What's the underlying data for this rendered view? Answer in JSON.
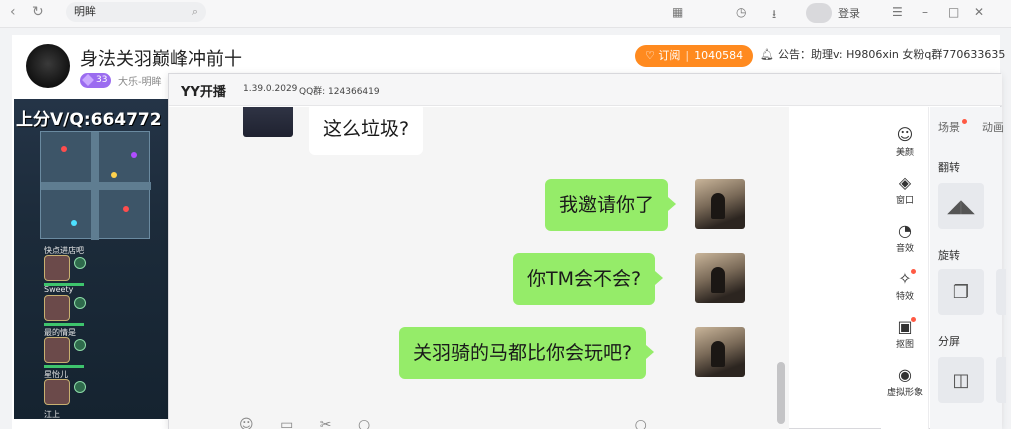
{
  "browser": {
    "search_value": "明眸",
    "search_icon": "search-icon",
    "login_label": "登录"
  },
  "room": {
    "title": "身法关羽巅峰冲前十",
    "level": "33",
    "channel": "大乐-明眸",
    "subscribe_label": "订阅",
    "subscribe_count": "1040584",
    "notice": "公告：助理v: H9806xin 女粉q群770633635"
  },
  "video": {
    "overlay_text": "上分V/Q:664772",
    "heroes": [
      {
        "name": "快点进店吧"
      },
      {
        "name": "Sweety"
      },
      {
        "name": "最的情是"
      },
      {
        "name": "星怡儿"
      },
      {
        "name": "江上"
      }
    ]
  },
  "yy": {
    "logo": "YY开播",
    "version": "1.39.0.2029",
    "qq_group": "QQ群: 124366419"
  },
  "chat": {
    "messages": [
      {
        "side": "left",
        "text": "这么垃圾?"
      },
      {
        "side": "right",
        "text": "我邀请你了"
      },
      {
        "side": "right",
        "text": "你TM会不会?"
      },
      {
        "side": "right",
        "text": "关羽骑的马都比你会玩吧?"
      }
    ]
  },
  "side_toolbar": {
    "items": [
      {
        "label": "美颜",
        "icon": "beauty-icon"
      },
      {
        "label": "窗口",
        "icon": "layers-icon"
      },
      {
        "label": "音效",
        "icon": "sound-icon"
      },
      {
        "label": "特效",
        "icon": "magic-wand-icon"
      },
      {
        "label": "抠图",
        "icon": "cutout-icon"
      },
      {
        "label": "虚拟形象",
        "icon": "avatar-icon"
      }
    ]
  },
  "settings": {
    "tab_scene": "场景",
    "tab_anim": "动画",
    "flip_label": "翻转",
    "rotate_label": "旋转",
    "split_label": "分屏"
  }
}
